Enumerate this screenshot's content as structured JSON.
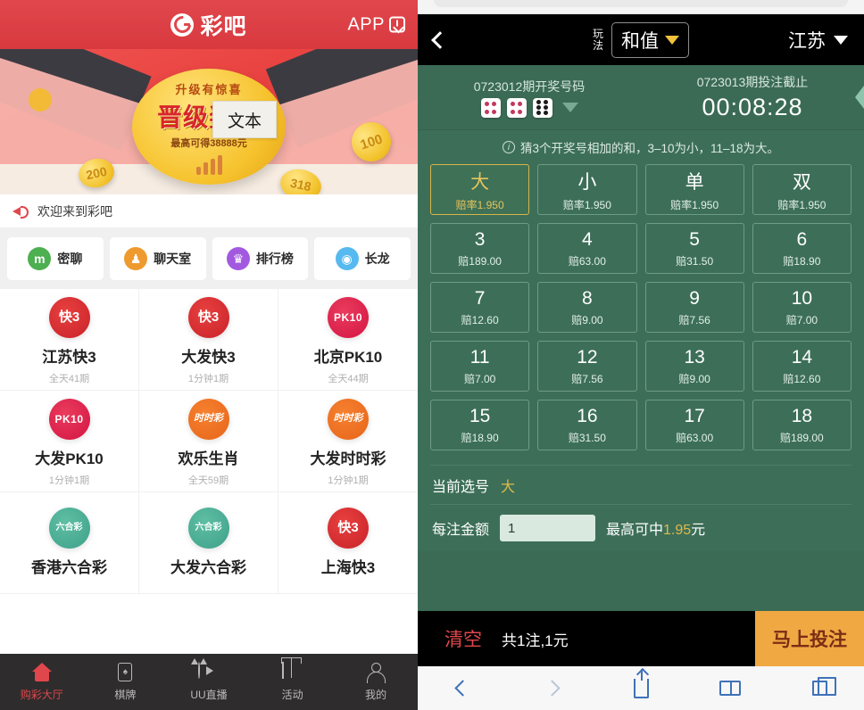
{
  "left": {
    "brand_name": "彩吧",
    "app_label": "APP",
    "app_icon": "download-icon",
    "banner": {
      "headline": "升级有惊喜",
      "title": "晋级奖励",
      "subtitle": "最高可得38888元",
      "coin_100": "100",
      "coin_200": "200",
      "coin_318": "318",
      "tooltip": "文本"
    },
    "notice": {
      "icon": "speaker-icon",
      "text": "欢迎来到彩吧"
    },
    "quick_links": [
      {
        "label": "密聊",
        "icon": "mi-chat-icon",
        "color": "#4caf50",
        "glyph": "m"
      },
      {
        "label": "聊天室",
        "icon": "chatroom-icon",
        "color": "#ef9a2e",
        "glyph": "⚇"
      },
      {
        "label": "排行榜",
        "icon": "crown-icon",
        "color": "#a259e0",
        "glyph": "♛"
      },
      {
        "label": "长龙",
        "icon": "dragon-icon",
        "color": "#56b9ef",
        "glyph": "Œ"
      }
    ],
    "lotteries": [
      {
        "name": "江苏快3",
        "sub": "全天41期",
        "icon": "k3-icon",
        "badge": "快3"
      },
      {
        "name": "大发快3",
        "sub": "1分钟1期",
        "icon": "k3-icon",
        "badge": "快3"
      },
      {
        "name": "北京PK10",
        "sub": "全天44期",
        "icon": "pk10-icon",
        "badge": "PK10"
      },
      {
        "name": "大发PK10",
        "sub": "1分钟1期",
        "icon": "pk10-icon",
        "badge": "PK10"
      },
      {
        "name": "欢乐生肖",
        "sub": "全天59期",
        "icon": "ssc-icon",
        "badge": "时时彩"
      },
      {
        "name": "大发时时彩",
        "sub": "1分钟1期",
        "icon": "ssc-icon",
        "badge": "时时彩"
      },
      {
        "name": "香港六合彩",
        "sub": "",
        "icon": "lhc-icon",
        "badge": "六合彩"
      },
      {
        "name": "大发六合彩",
        "sub": "",
        "icon": "lhc-icon",
        "badge": "六合彩"
      },
      {
        "name": "上海快3",
        "sub": "",
        "icon": "k3-icon",
        "badge": "快3"
      }
    ],
    "tabs": [
      {
        "label": "购彩大厅",
        "icon": "home-icon",
        "active": true
      },
      {
        "label": "棋牌",
        "icon": "cards-icon",
        "active": false
      },
      {
        "label": "UU直播",
        "icon": "live-icon",
        "active": false
      },
      {
        "label": "活动",
        "icon": "gift-icon",
        "active": false
      },
      {
        "label": "我的",
        "icon": "user-icon",
        "active": false
      }
    ]
  },
  "right": {
    "header": {
      "back_icon": "back-chevron-icon",
      "play_label": "玩法",
      "play_value": "和值",
      "play_caret": "caret-down-icon",
      "region_value": "江苏",
      "region_caret": "caret-down-icon"
    },
    "draw": {
      "result_caption": "0723012期开奖号码",
      "dice": [
        {
          "value": 4,
          "color": "red"
        },
        {
          "value": 4,
          "color": "red"
        },
        {
          "value": 6,
          "color": "black"
        }
      ],
      "expand_icon": "caret-down-icon",
      "countdown_caption": "0723013期投注截止",
      "countdown": "00:08:28"
    },
    "hint": {
      "icon": "info-icon",
      "text": "猜3个开奖号相加的和，3–10为小，11–18为大。"
    },
    "bet_options": [
      {
        "main": "大",
        "sub": "赔率1.950",
        "selected": true
      },
      {
        "main": "小",
        "sub": "赔率1.950",
        "selected": false
      },
      {
        "main": "单",
        "sub": "赔率1.950",
        "selected": false
      },
      {
        "main": "双",
        "sub": "赔率1.950",
        "selected": false
      },
      {
        "main": "3",
        "sub": "赔189.00",
        "selected": false
      },
      {
        "main": "4",
        "sub": "赔63.00",
        "selected": false
      },
      {
        "main": "5",
        "sub": "赔31.50",
        "selected": false
      },
      {
        "main": "6",
        "sub": "赔18.90",
        "selected": false
      },
      {
        "main": "7",
        "sub": "赔12.60",
        "selected": false
      },
      {
        "main": "8",
        "sub": "赔9.00",
        "selected": false
      },
      {
        "main": "9",
        "sub": "赔7.56",
        "selected": false
      },
      {
        "main": "10",
        "sub": "赔7.00",
        "selected": false
      },
      {
        "main": "11",
        "sub": "赔7.00",
        "selected": false
      },
      {
        "main": "12",
        "sub": "赔7.56",
        "selected": false
      },
      {
        "main": "13",
        "sub": "赔9.00",
        "selected": false
      },
      {
        "main": "14",
        "sub": "赔12.60",
        "selected": false
      },
      {
        "main": "15",
        "sub": "赔18.90",
        "selected": false
      },
      {
        "main": "16",
        "sub": "赔31.50",
        "selected": false
      },
      {
        "main": "17",
        "sub": "赔63.00",
        "selected": false
      },
      {
        "main": "18",
        "sub": "赔189.00",
        "selected": false
      }
    ],
    "current_pick": {
      "label": "当前选号",
      "value": "大"
    },
    "amount": {
      "label": "每注金额",
      "value": "1",
      "placeholder": "1",
      "hint_prefix": "最高可中",
      "hint_amount": "1.95",
      "hint_suffix": "元"
    },
    "actions": {
      "clear_label": "清空",
      "total_text": "共1注,1元",
      "submit_label": "马上投注"
    },
    "browser_bar": [
      {
        "icon": "back-icon"
      },
      {
        "icon": "forward-icon"
      },
      {
        "icon": "share-icon"
      },
      {
        "icon": "bookmarks-icon"
      },
      {
        "icon": "tabs-icon"
      }
    ]
  },
  "colors": {
    "brand_red": "#e0474c",
    "green_bg": "#3d6f58",
    "gold": "#e0b84c",
    "orange": "#f0a843"
  }
}
